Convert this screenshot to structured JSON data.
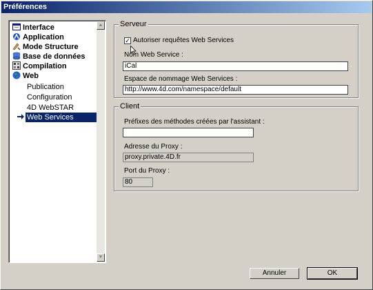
{
  "window": {
    "title": "Préférences"
  },
  "tree": [
    {
      "label": "Interface",
      "icon": "interface-icon"
    },
    {
      "label": "Application",
      "icon": "application-icon"
    },
    {
      "label": "Mode Structure",
      "icon": "structure-icon"
    },
    {
      "label": "Base de données",
      "icon": "database-icon"
    },
    {
      "label": "Compilation",
      "icon": "compilation-icon"
    },
    {
      "label": "Web",
      "icon": "web-globe-icon"
    },
    {
      "label": "Publication"
    },
    {
      "label": "Configuration"
    },
    {
      "label": "4D WebSTAR"
    },
    {
      "label": "Web Services",
      "icon": "arrow-right-icon",
      "selected": true
    }
  ],
  "serveur": {
    "title": "Serveur",
    "allow_label": "Autoriser requêtes Web Services",
    "allow_checked": true,
    "name_label": "Nom Web Service :",
    "name_value": "iCal",
    "namespace_label": "Espace de nommage Web Services :",
    "namespace_value": "http://www.4d.com/namespace/default"
  },
  "client": {
    "title": "Client",
    "prefix_label": "Préfixes des méthodes créées par l'assistant :",
    "prefix_value": "",
    "proxy_label": "Adresse du Proxy :",
    "proxy_value": "proxy.private.4D.fr",
    "port_label": "Port du Proxy :",
    "port_value": "80"
  },
  "buttons": {
    "cancel": "Annuler",
    "ok": "OK"
  }
}
